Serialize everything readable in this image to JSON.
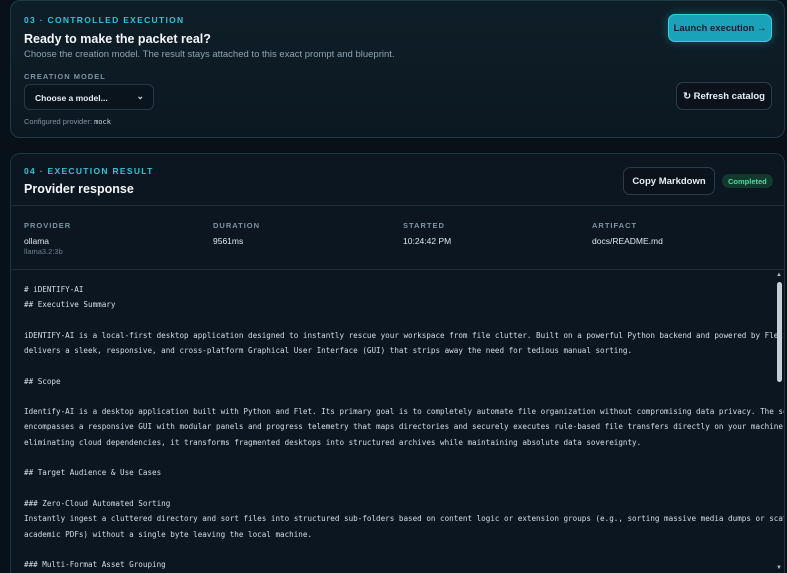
{
  "exec": {
    "eyebrow": "03 · CONTROLLED EXECUTION",
    "title": "Ready to make the packet real?",
    "subtitle": "Choose the creation model. The result stays attached to this exact prompt and blueprint.",
    "model_label": "CREATION MODEL",
    "model_selected": "Choose a model...",
    "provider_prefix": "Configured provider:",
    "provider_value": "mock",
    "launch_label": "Launch execution →",
    "refresh_label": "↻ Refresh catalog"
  },
  "result": {
    "eyebrow": "04 · EXECUTION RESULT",
    "title": "Provider response",
    "copy_label": "Copy Markdown",
    "status": "Completed",
    "meta": {
      "provider_label": "PROVIDER",
      "provider_value": "ollama",
      "provider_sub": "llama3.2:3b",
      "duration_label": "DURATION",
      "duration_value": "9561ms",
      "started_label": "STARTED",
      "started_value": "10:24:42 PM",
      "artifact_label": "ARTIFACT",
      "artifact_value": "docs/README.md"
    },
    "lines": [
      "# iDENTIFY-AI",
      "## Executive Summary",
      "iDENTIFY-AI is a local-first desktop application designed to instantly rescue your workspace from file clutter. Built on a powerful Python backend and powered by Flet, it",
      "delivers a sleek, responsive, and cross-platform Graphical User Interface (GUI) that strips away the need for tedious manual sorting.",
      "## Scope",
      "Identify-AI is a desktop application built with Python and Flet. Its primary goal is to completely automate file organization without compromising data privacy. The scope",
      "encompasses a responsive GUI with modular panels and progress telemetry that maps directories and securely executes rule-based file transfers directly on your machine. By",
      "eliminating cloud dependencies, it transforms fragmented desktops into structured archives while maintaining absolute data sovereignty.",
      "## Target Audience & Use Cases",
      "### Zero-Cloud Automated Sorting",
      "Instantly ingest a cluttered directory and sort files into structured sub-folders based on content logic or extension groups (e.g., sorting massive media dumps or scattered",
      "academic PDFs) without a single byte leaving the local machine.",
      "### Multi-Format Asset Grouping"
    ]
  }
}
